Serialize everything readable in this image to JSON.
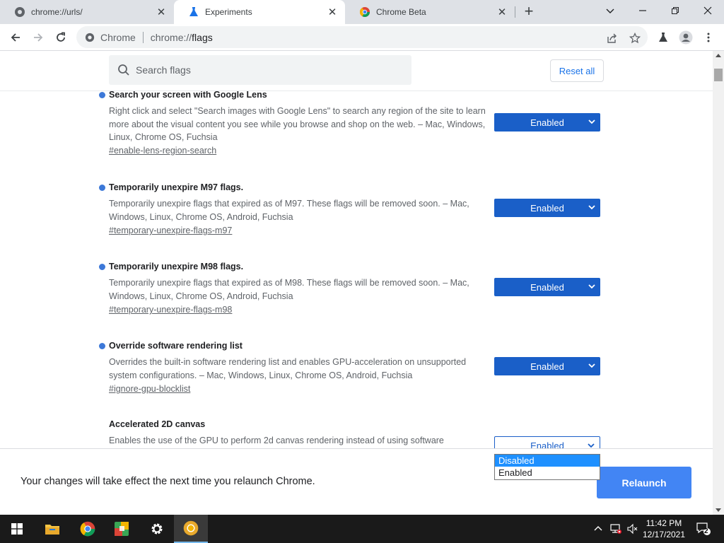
{
  "tabs": [
    {
      "title": "chrome://urls/",
      "icon": "chrome-settings-icon",
      "active": false
    },
    {
      "title": "Experiments",
      "icon": "flask-icon",
      "active": true
    },
    {
      "title": "Chrome Beta",
      "icon": "chrome-beta-icon",
      "active": false
    }
  ],
  "omnibox": {
    "chip": "Chrome",
    "url_prefix": "chrome://",
    "url_rest": "flags"
  },
  "search": {
    "placeholder": "Search flags",
    "reset_label": "Reset all"
  },
  "flags": [
    {
      "name": "Search your screen with Google Lens",
      "description": "Right click and select \"Search images with Google Lens\" to search any region of the site to learn more about the visual content you see while you browse and shop on the web. – Mac, Windows, Linux, Chrome OS, Fuchsia",
      "link": "#enable-lens-region-search",
      "value": "Enabled",
      "modified": true
    },
    {
      "name": "Temporarily unexpire M97 flags.",
      "description": "Temporarily unexpire flags that expired as of M97. These flags will be removed soon. – Mac, Windows, Linux, Chrome OS, Android, Fuchsia",
      "link": "#temporary-unexpire-flags-m97",
      "value": "Enabled",
      "modified": true
    },
    {
      "name": "Temporarily unexpire M98 flags.",
      "description": "Temporarily unexpire flags that expired as of M98. These flags will be removed soon. – Mac, Windows, Linux, Chrome OS, Android, Fuchsia",
      "link": "#temporary-unexpire-flags-m98",
      "value": "Enabled",
      "modified": true
    },
    {
      "name": "Override software rendering list",
      "description": "Overrides the built-in software rendering list and enables GPU-acceleration on unsupported system configurations. – Mac, Windows, Linux, Chrome OS, Android, Fuchsia",
      "link": "#ignore-gpu-blocklist",
      "value": "Enabled",
      "modified": true
    },
    {
      "name": "Accelerated 2D canvas",
      "description": "Enables the use of the GPU to perform 2d canvas rendering instead of using software",
      "link": "",
      "value": "Enabled",
      "modified": false
    }
  ],
  "dropdown_options": [
    "Disabled",
    "Enabled"
  ],
  "dropdown_highlighted": "Disabled",
  "relaunch": {
    "message": "Your changes will take effect the next time you relaunch Chrome.",
    "button": "Relaunch"
  },
  "taskbar": {
    "time": "11:42 PM",
    "date": "12/17/2021",
    "notifications": "2"
  },
  "colors": {
    "accent": "#1a73e8",
    "select_bg": "#1a5fc8",
    "relaunch_bg": "#4285f4",
    "modified_dot": "#3c78d8"
  }
}
